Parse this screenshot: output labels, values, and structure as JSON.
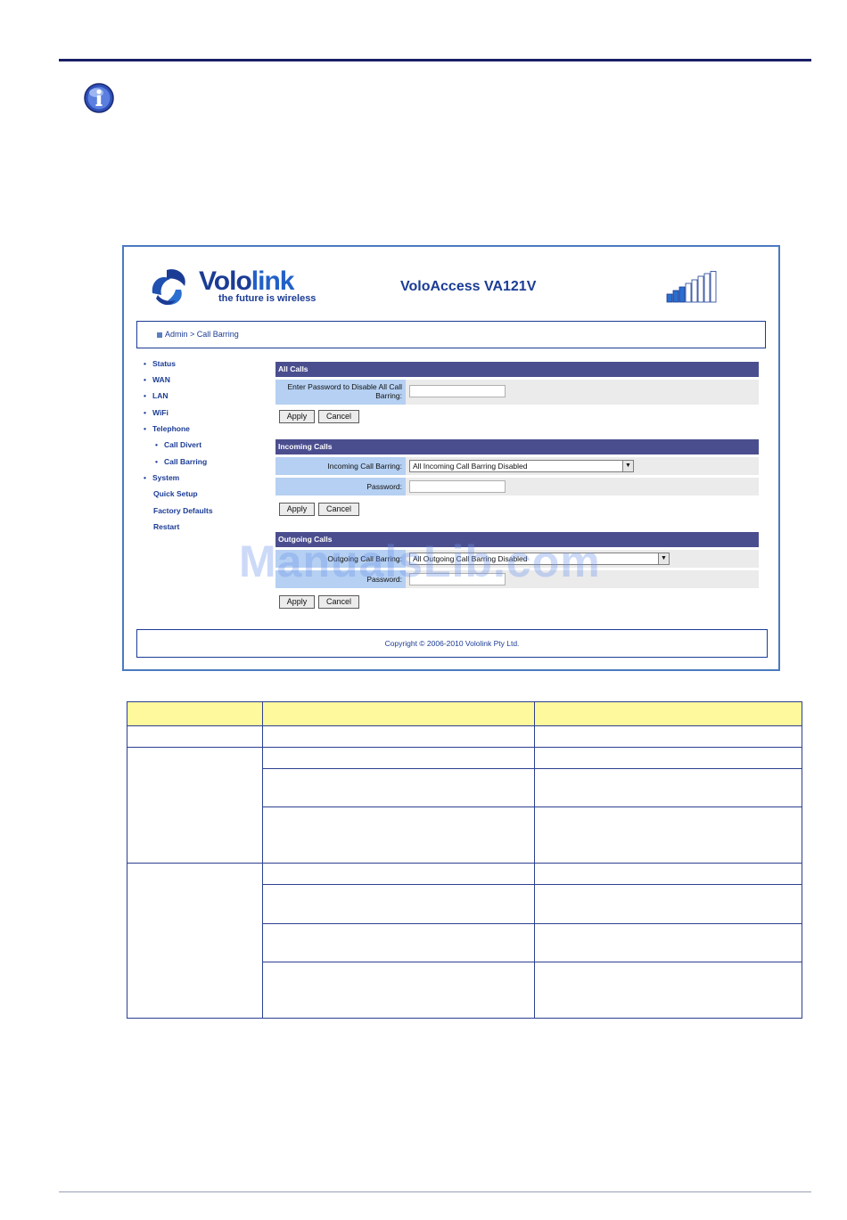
{
  "app": {
    "brand_name_part1": "Volo",
    "brand_name_part2": "link",
    "tagline": "the future is wireless",
    "product": "VoloAccess VA121V"
  },
  "breadcrumb": "Admin > Call Barring",
  "nav": {
    "items": [
      "Status",
      "WAN",
      "LAN",
      "WiFi",
      "Telephone"
    ],
    "telephone_sub": [
      "Call Divert",
      "Call Barring"
    ],
    "system": "System",
    "system_sub": [
      "Quick Setup",
      "Factory Defaults",
      "Restart"
    ]
  },
  "all_calls": {
    "title": "All Calls",
    "password_label": "Enter Password to Disable All Call Barring:",
    "password_value": "",
    "apply": "Apply",
    "cancel": "Cancel"
  },
  "incoming_calls": {
    "title": "Incoming Calls",
    "barring_label": "Incoming Call Barring:",
    "barring_value": "All Incoming Call Barring Disabled",
    "password_label": "Password:",
    "password_value": "",
    "apply": "Apply",
    "cancel": "Cancel"
  },
  "outgoing_calls": {
    "title": "Outgoing Calls",
    "barring_label": "Outgoing Call Barring:",
    "barring_value": "All Outgoing Call Barring Disabled",
    "password_label": "Password:",
    "password_value": "",
    "apply": "Apply",
    "cancel": "Cancel"
  },
  "footer": "Copyright © 2006-2010 Vololink Pty Ltd.",
  "watermark": "ManualsLib.com",
  "colors": {
    "brand_blue": "#1b3c95",
    "section_header": "#4b4e8e",
    "label_cell": "#b5d0f2",
    "table_header": "#fff99d"
  }
}
